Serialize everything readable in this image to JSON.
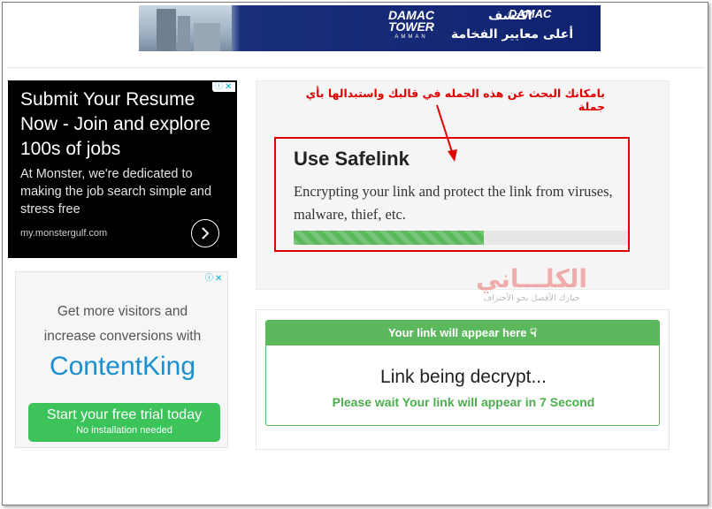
{
  "banner": {
    "brand_left": "DAMAC TOWER",
    "brand_left_sub": "AMMAN",
    "brand_right": "DAMAC",
    "arabic_line1": "اكتشف",
    "arabic_line2": "أعلى معايير الفخامة"
  },
  "annotation": {
    "note": "بامكانك البحث عن هذه الجمله في قالبك واستبدالها بأي جملة"
  },
  "ad_monster": {
    "headline": "Submit Your Resume Now - Join and explore 100s of jobs",
    "body": "At Monster, we're dedicated to making the job search simple and stress free",
    "domain": "my.monstergulf.com",
    "ad_choices_icon": "info-icon",
    "close_icon": "close-icon"
  },
  "ad_contentking": {
    "line1": "Get more visitors and",
    "line2": "increase conversions with",
    "brand": "ContentKing",
    "cta_main": "Start your free trial today",
    "cta_sub": "No installation needed"
  },
  "safelink": {
    "title": "Use Safelink",
    "description": "Encrypting your link and protect the link from viruses, malware, thief, etc.",
    "progress": 0.57
  },
  "watermark": {
    "line1": "الكلـــاني",
    "line2": "خيارك الأفضل نحو الأحتراف"
  },
  "link_card": {
    "header": "Your link will appear here",
    "title": "Link being decrypt...",
    "status": "Please wait Your link will appear in 7 Second"
  },
  "colors": {
    "accent_green": "#5cb85c",
    "annotation_red": "#e00000",
    "banner_blue": "#0f2270",
    "ad_brand_blue": "#1a8fd0"
  }
}
